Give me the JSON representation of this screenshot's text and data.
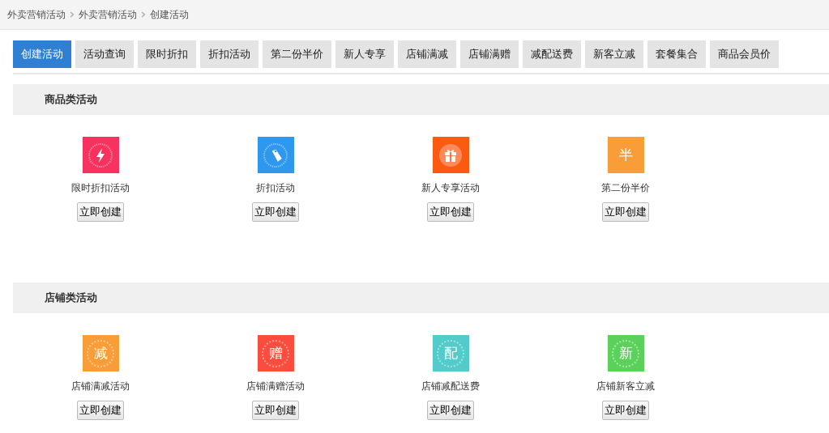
{
  "breadcrumb": [
    "外卖营销活动",
    "外卖营销活动",
    "创建活动"
  ],
  "tabs": [
    {
      "label": "创建活动",
      "selected": true
    },
    {
      "label": "活动查询",
      "selected": false
    },
    {
      "label": "限时折扣",
      "selected": false
    },
    {
      "label": "折扣活动",
      "selected": false
    },
    {
      "label": "第二份半价",
      "selected": false
    },
    {
      "label": "新人专享",
      "selected": false
    },
    {
      "label": "店铺满减",
      "selected": false
    },
    {
      "label": "店铺满赠",
      "selected": false
    },
    {
      "label": "减配送费",
      "selected": false
    },
    {
      "label": "新客立减",
      "selected": false
    },
    {
      "label": "套餐集合",
      "selected": false
    },
    {
      "label": "商品会员价",
      "selected": false
    }
  ],
  "sections": [
    {
      "title": "商品类活动",
      "items": [
        {
          "kind": "bolt",
          "color": "#f7325f",
          "label": "限时折扣活动",
          "button": "立即创建"
        },
        {
          "kind": "tag",
          "color": "#2e98ee",
          "label": "折扣活动",
          "button": "立即创建"
        },
        {
          "kind": "gift",
          "color": "#fb5a12",
          "label": "新人专享活动",
          "button": "立即创建"
        },
        {
          "kind": "glyph",
          "glyph": "半",
          "ring": false,
          "color": "#f99d38",
          "label": "第二份半价",
          "button": "立即创建"
        }
      ]
    },
    {
      "title": "店铺类活动",
      "items": [
        {
          "kind": "glyph",
          "glyph": "减",
          "ring": true,
          "color": "#f99d38",
          "label": "店铺满减活动",
          "button": "立即创建"
        },
        {
          "kind": "glyph",
          "glyph": "赠",
          "ring": true,
          "color": "#fb4c3e",
          "label": "店铺满赠活动",
          "button": "立即创建"
        },
        {
          "kind": "glyph",
          "glyph": "配",
          "ring": true,
          "color": "#54cbcb",
          "label": "店铺减配送费",
          "button": "立即创建"
        },
        {
          "kind": "glyph",
          "glyph": "新",
          "ring": true,
          "color": "#5bd15b",
          "label": "店铺新客立减",
          "button": "立即创建"
        }
      ]
    }
  ]
}
